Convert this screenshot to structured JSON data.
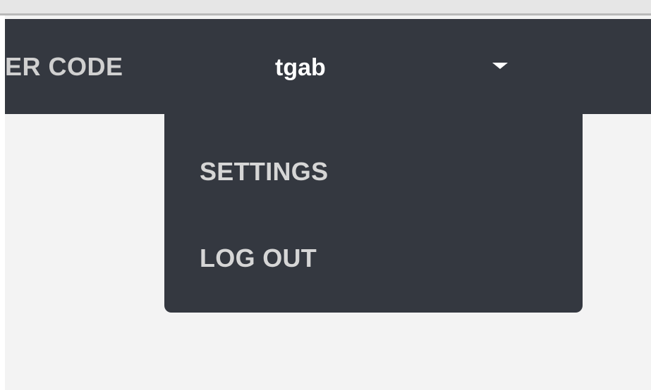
{
  "navbar": {
    "partial_link": "ER CODE",
    "username": "tgab",
    "caret_icon": "caret-down-icon"
  },
  "user_menu": {
    "items": [
      {
        "label": "SETTINGS"
      },
      {
        "label": "LOG OUT"
      }
    ]
  },
  "colors": {
    "navbar_bg": "#343840",
    "page_bg": "#f3f3f3",
    "menu_text": "#d6d6d6",
    "username_text": "#ffffff"
  }
}
